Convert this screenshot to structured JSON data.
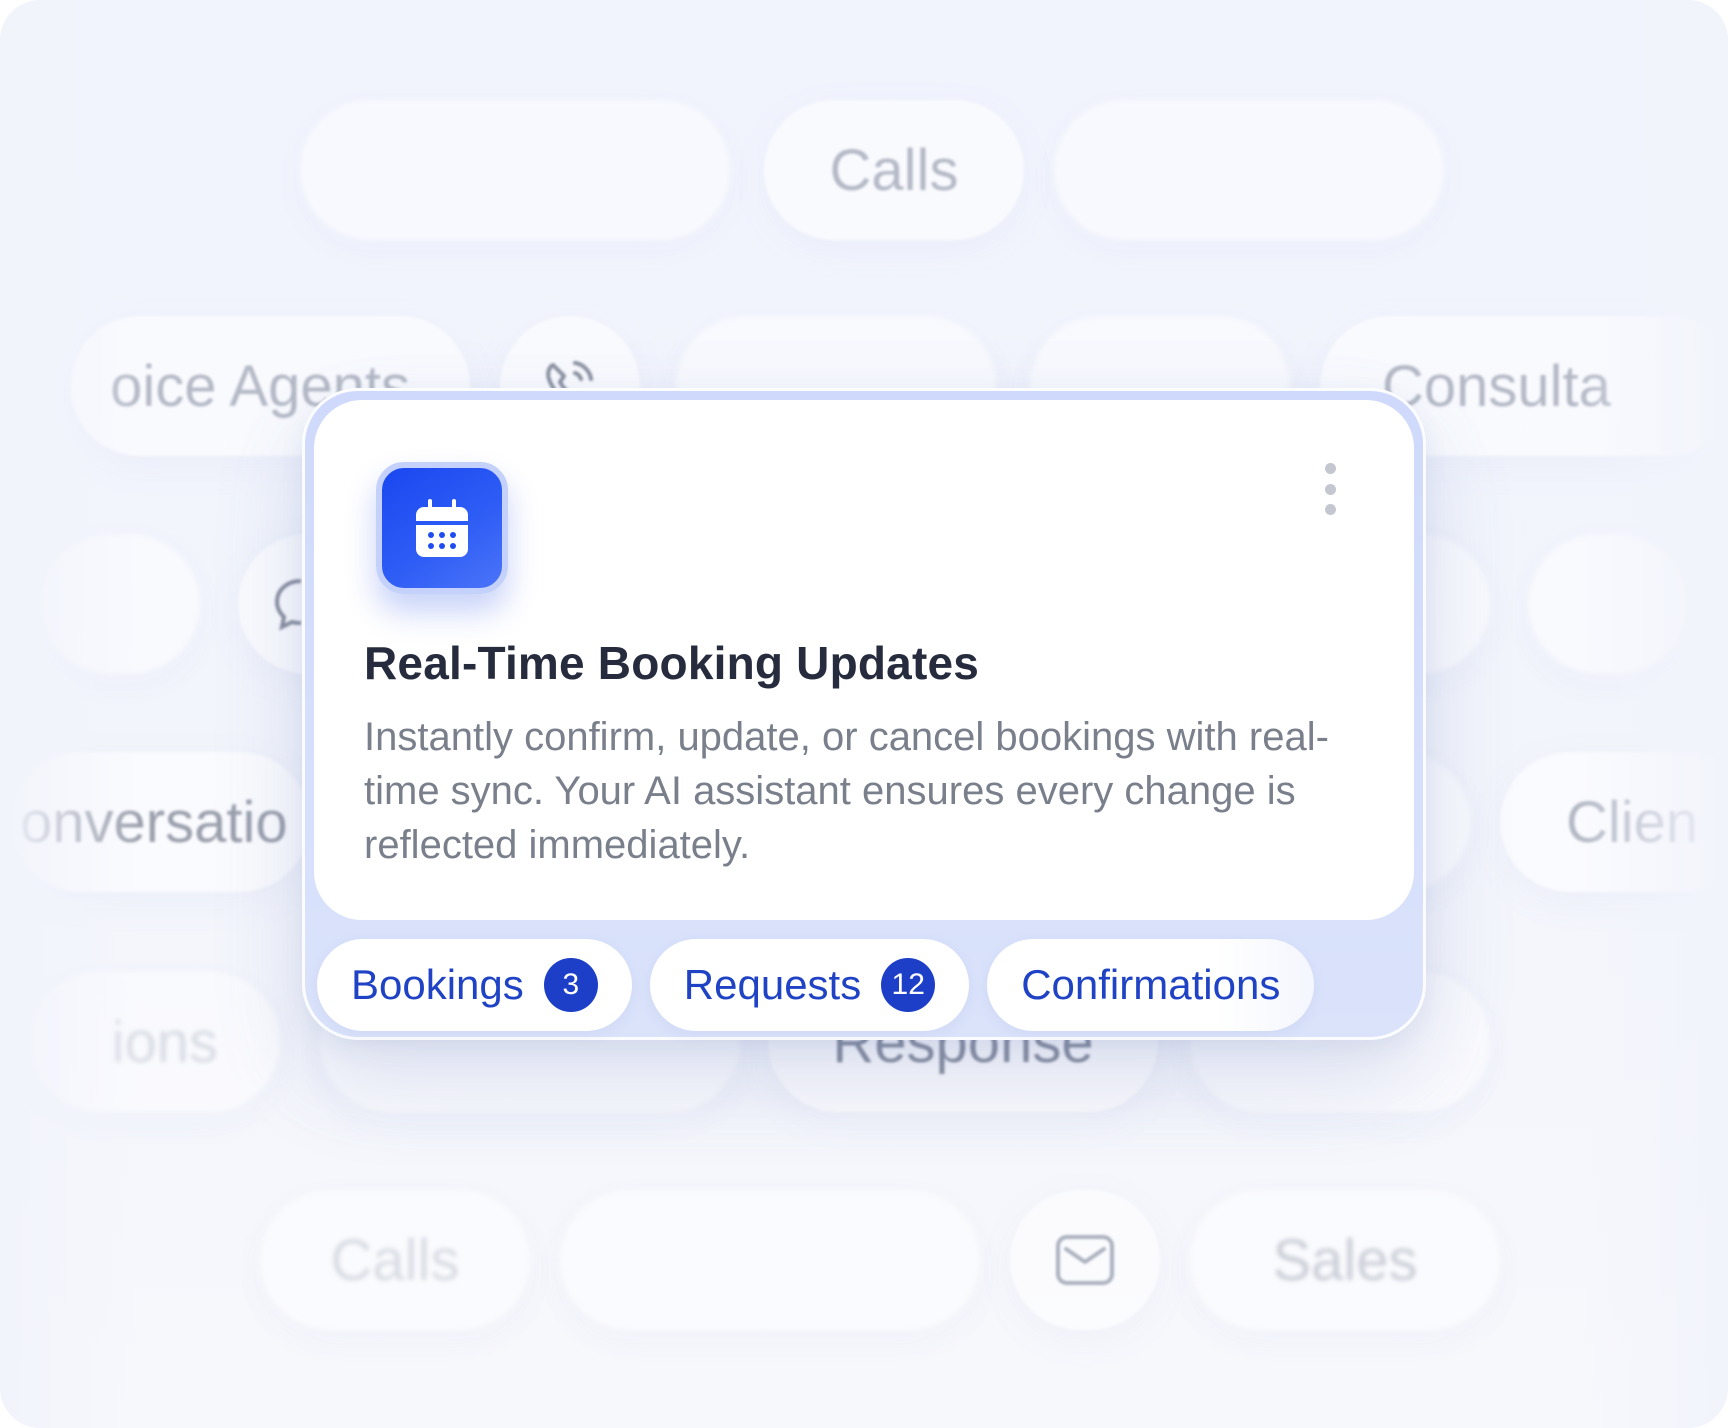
{
  "background": {
    "chips": [
      {
        "text": "Calls"
      },
      {
        "text": "oice Agents"
      },
      {
        "text": "Consulta"
      },
      {
        "text": "onversatio"
      },
      {
        "text": "Clien"
      },
      {
        "text": "ions"
      },
      {
        "text": "Response"
      },
      {
        "text": "Calls"
      },
      {
        "text": "Sales"
      }
    ],
    "icons": [
      "phone-ringing-icon",
      "chat-bubble-icon",
      "mail-icon"
    ]
  },
  "card": {
    "icon": "calendar-icon",
    "menu_icon": "kebab-menu-icon",
    "title": "Real-Time Booking Updates",
    "description": "Instantly confirm, update, or cancel bookings with real-time sync. Your AI assistant ensures every change is reflected immediately.",
    "tabs": [
      {
        "label": "Bookings",
        "count": "3"
      },
      {
        "label": "Requests",
        "count": "12"
      },
      {
        "label": "Confirmations"
      }
    ]
  },
  "colors": {
    "accent": "#1f43c4",
    "badge": "#1d3fc7",
    "icon_gradient_start": "#1a47f0",
    "title": "#262c3d",
    "body_text": "#7a7f8c"
  }
}
